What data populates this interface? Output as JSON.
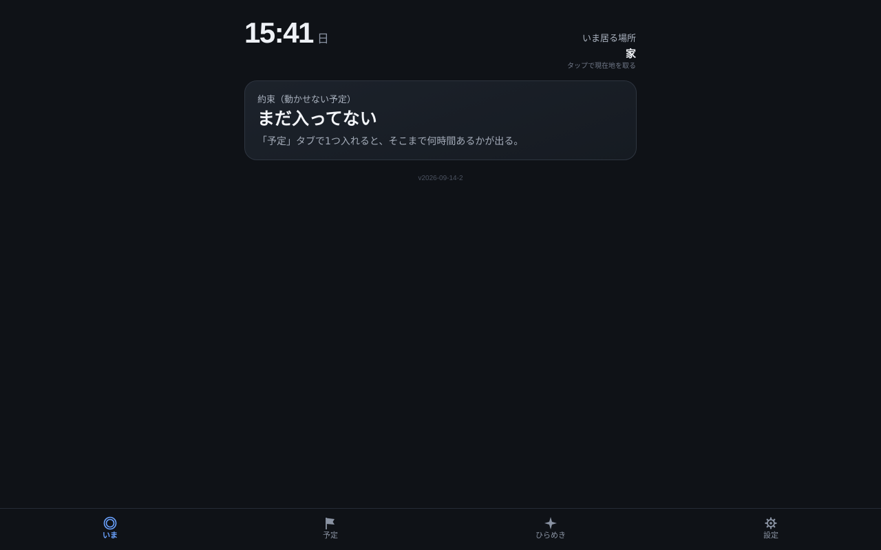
{
  "header": {
    "time": "15:41",
    "day": "日",
    "location": {
      "label": "いま居る場所",
      "name": "家",
      "hint": "タップで現在地を取る"
    }
  },
  "card": {
    "kicker": "約束（動かせない予定）",
    "title": "まだ入ってない",
    "description": "「予定」タブで1つ入れると、そこまで何時間あるかが出る。"
  },
  "version": "v2026-09-14-2",
  "tabbar": {
    "tabs": [
      {
        "label": "いま",
        "icon": "circle-icon",
        "active": true
      },
      {
        "label": "予定",
        "icon": "flag-icon",
        "active": false
      },
      {
        "label": "ひらめき",
        "icon": "sparkle-icon",
        "active": false
      },
      {
        "label": "設定",
        "icon": "gear-icon",
        "active": false
      }
    ]
  },
  "colors": {
    "background": "#0f1217",
    "accent": "#6aa2ff",
    "muted": "#8a93a3"
  }
}
